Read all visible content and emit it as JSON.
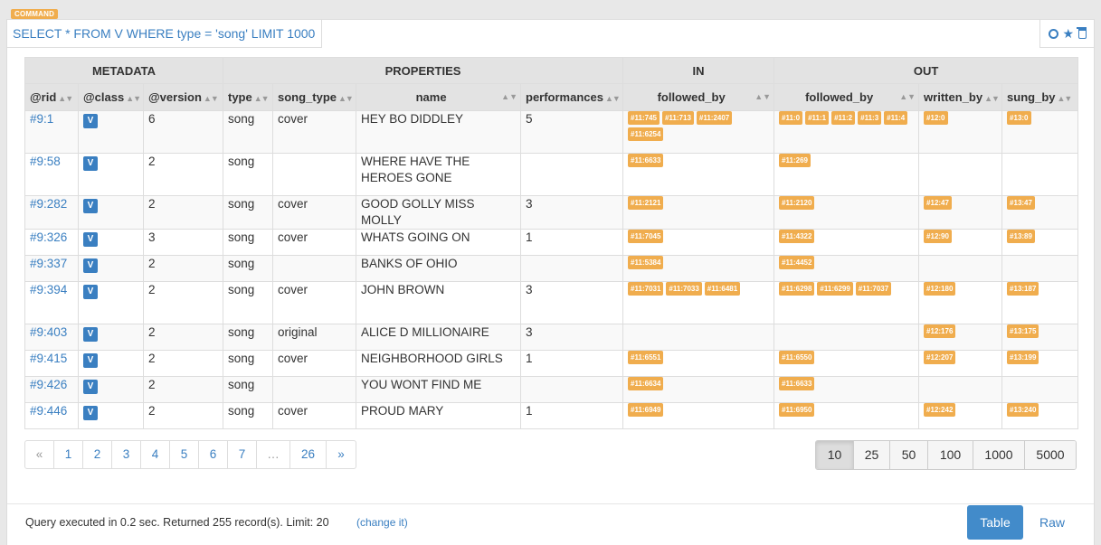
{
  "command_badge": "COMMAND",
  "query": "SELECT * FROM V WHERE type = 'song' LIMIT 1000",
  "groups": [
    "METADATA",
    "PROPERTIES",
    "IN",
    "OUT"
  ],
  "columns": [
    "@rid",
    "@class",
    "@version",
    "type",
    "song_type",
    "name",
    "performances",
    "followed_by",
    "followed_by",
    "written_by",
    "sung_by"
  ],
  "rows": [
    {
      "rid": "#9:1",
      "class": "V",
      "version": "6",
      "type": "song",
      "song_type": "cover",
      "name": "HEY BO DIDDLEY",
      "performances": "5",
      "in_followed_by": [
        "#11:745",
        "#11:713",
        "#11:2407",
        "#11:6254"
      ],
      "out_followed_by": [
        "#11:0",
        "#11:1",
        "#11:2",
        "#11:3",
        "#11:4"
      ],
      "written_by": [
        "#12:0"
      ],
      "sung_by": [
        "#13:0"
      ]
    },
    {
      "rid": "#9:58",
      "class": "V",
      "version": "2",
      "type": "song",
      "song_type": "",
      "name": "WHERE HAVE THE HEROES GONE",
      "performances": "",
      "in_followed_by": [
        "#11:6633"
      ],
      "out_followed_by": [
        "#11:269"
      ],
      "written_by": [],
      "sung_by": []
    },
    {
      "rid": "#9:282",
      "class": "V",
      "version": "2",
      "type": "song",
      "song_type": "cover",
      "name": "GOOD GOLLY MISS MOLLY",
      "performances": "3",
      "in_followed_by": [
        "#11:2121"
      ],
      "out_followed_by": [
        "#11:2120"
      ],
      "written_by": [
        "#12:47"
      ],
      "sung_by": [
        "#13:47"
      ]
    },
    {
      "rid": "#9:326",
      "class": "V",
      "version": "3",
      "type": "song",
      "song_type": "cover",
      "name": "WHATS GOING ON",
      "performances": "1",
      "in_followed_by": [
        "#11:7045"
      ],
      "out_followed_by": [
        "#11:4322"
      ],
      "written_by": [
        "#12:90"
      ],
      "sung_by": [
        "#13:89"
      ]
    },
    {
      "rid": "#9:337",
      "class": "V",
      "version": "2",
      "type": "song",
      "song_type": "",
      "name": "BANKS OF OHIO",
      "performances": "",
      "in_followed_by": [
        "#11:5384"
      ],
      "out_followed_by": [
        "#11:4452"
      ],
      "written_by": [],
      "sung_by": []
    },
    {
      "rid": "#9:394",
      "class": "V",
      "version": "2",
      "type": "song",
      "song_type": "cover",
      "name": "JOHN BROWN",
      "performances": "3",
      "in_followed_by": [
        "#11:7031",
        "#11:7033",
        "#11:6481"
      ],
      "out_followed_by": [
        "#11:6298",
        "#11:6299",
        "#11:7037"
      ],
      "written_by": [
        "#12:180"
      ],
      "sung_by": [
        "#13:187"
      ]
    },
    {
      "rid": "#9:403",
      "class": "V",
      "version": "2",
      "type": "song",
      "song_type": "original",
      "name": "ALICE D MILLIONAIRE",
      "performances": "3",
      "in_followed_by": [],
      "out_followed_by": [],
      "written_by": [
        "#12:176"
      ],
      "sung_by": [
        "#13:175"
      ]
    },
    {
      "rid": "#9:415",
      "class": "V",
      "version": "2",
      "type": "song",
      "song_type": "cover",
      "name": "NEIGHBORHOOD GIRLS",
      "performances": "1",
      "in_followed_by": [
        "#11:6551"
      ],
      "out_followed_by": [
        "#11:6550"
      ],
      "written_by": [
        "#12:207"
      ],
      "sung_by": [
        "#13:199"
      ]
    },
    {
      "rid": "#9:426",
      "class": "V",
      "version": "2",
      "type": "song",
      "song_type": "",
      "name": "YOU WONT FIND ME",
      "performances": "",
      "in_followed_by": [
        "#11:6634"
      ],
      "out_followed_by": [
        "#11:6633"
      ],
      "written_by": [],
      "sung_by": []
    },
    {
      "rid": "#9:446",
      "class": "V",
      "version": "2",
      "type": "song",
      "song_type": "cover",
      "name": "PROUD MARY",
      "performances": "1",
      "in_followed_by": [
        "#11:6949"
      ],
      "out_followed_by": [
        "#11:6950"
      ],
      "written_by": [
        "#12:242"
      ],
      "sung_by": [
        "#13:240"
      ]
    }
  ],
  "pagination": [
    "«",
    "1",
    "2",
    "3",
    "4",
    "5",
    "6",
    "7",
    "…",
    "26",
    "»"
  ],
  "page_limits": [
    "10",
    "25",
    "50",
    "100",
    "1000",
    "5000"
  ],
  "active_limit": "10",
  "footer": {
    "status": "Query executed in 0.2 sec. Returned 255 record(s). Limit: 20",
    "change_link": "(change it)",
    "table_button": "Table",
    "raw_button": "Raw"
  },
  "colors": {
    "accent": "#3a7fc1",
    "chip": "#f0ad4e",
    "primary_button": "#428bca"
  },
  "icons": [
    "circle-icon",
    "star-icon",
    "trash-icon"
  ]
}
